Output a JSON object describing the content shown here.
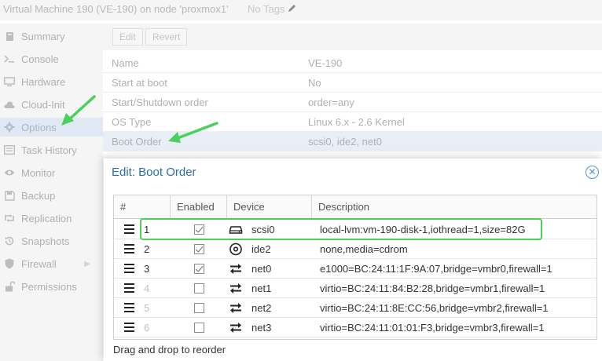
{
  "window": {
    "title": "Virtual Machine 190 (VE-190) on node 'proxmox1'",
    "tags_label": "No Tags"
  },
  "sidebar": {
    "items": [
      {
        "label": "Summary",
        "icon": "book-icon"
      },
      {
        "label": "Console",
        "icon": "terminal-icon"
      },
      {
        "label": "Hardware",
        "icon": "monitor-icon"
      },
      {
        "label": "Cloud-Init",
        "icon": "cloud-icon"
      },
      {
        "label": "Options",
        "icon": "gear-icon",
        "selected": true
      },
      {
        "label": "Task History",
        "icon": "list-icon"
      },
      {
        "label": "Monitor",
        "icon": "eye-icon"
      },
      {
        "label": "Backup",
        "icon": "floppy-icon"
      },
      {
        "label": "Replication",
        "icon": "retweet-icon"
      },
      {
        "label": "Snapshots",
        "icon": "history-icon"
      },
      {
        "label": "Firewall",
        "icon": "shield-icon",
        "expandable": true
      },
      {
        "label": "Permissions",
        "icon": "unlock-icon"
      }
    ]
  },
  "toolbar": {
    "edit_label": "Edit",
    "revert_label": "Revert"
  },
  "options": {
    "rows": [
      {
        "key": "Name",
        "value": "VE-190"
      },
      {
        "key": "Start at boot",
        "value": "No"
      },
      {
        "key": "Start/Shutdown order",
        "value": "order=any"
      },
      {
        "key": "OS Type",
        "value": "Linux 6.x - 2.6 Kernel"
      },
      {
        "key": "Boot Order",
        "value": "scsi0, ide2, net0"
      }
    ]
  },
  "dialog": {
    "title": "Edit: Boot Order",
    "columns": [
      "#",
      "Enabled",
      "Device",
      "Description"
    ],
    "rows": [
      {
        "num": "1",
        "enabled": true,
        "device": "scsi0",
        "icon": "hdd-icon",
        "description": "local-lvm:vm-190-disk-1,iothread=1,size=82G"
      },
      {
        "num": "2",
        "enabled": true,
        "device": "ide2",
        "icon": "cdrom-icon",
        "description": "none,media=cdrom"
      },
      {
        "num": "3",
        "enabled": true,
        "device": "net0",
        "icon": "exchange-icon",
        "description": "e1000=BC:24:11:1F:9A:07,bridge=vmbr0,firewall=1"
      },
      {
        "num": "4",
        "enabled": false,
        "device": "net1",
        "icon": "exchange-icon",
        "description": "virtio=BC:24:11:84:B2:28,bridge=vmbr1,firewall=1"
      },
      {
        "num": "5",
        "enabled": false,
        "device": "net2",
        "icon": "exchange-icon",
        "description": "virtio=BC:24:11:8E:CC:56,bridge=vmbr2,firewall=1"
      },
      {
        "num": "6",
        "enabled": false,
        "device": "net3",
        "icon": "exchange-icon",
        "description": "virtio=BC:24:11:01:01:F3,bridge=vmbr3,firewall=1"
      }
    ],
    "hint": "Drag and drop to reorder"
  },
  "colors": {
    "accent": "#2b6cb0",
    "highlight": "#4bd15a"
  }
}
